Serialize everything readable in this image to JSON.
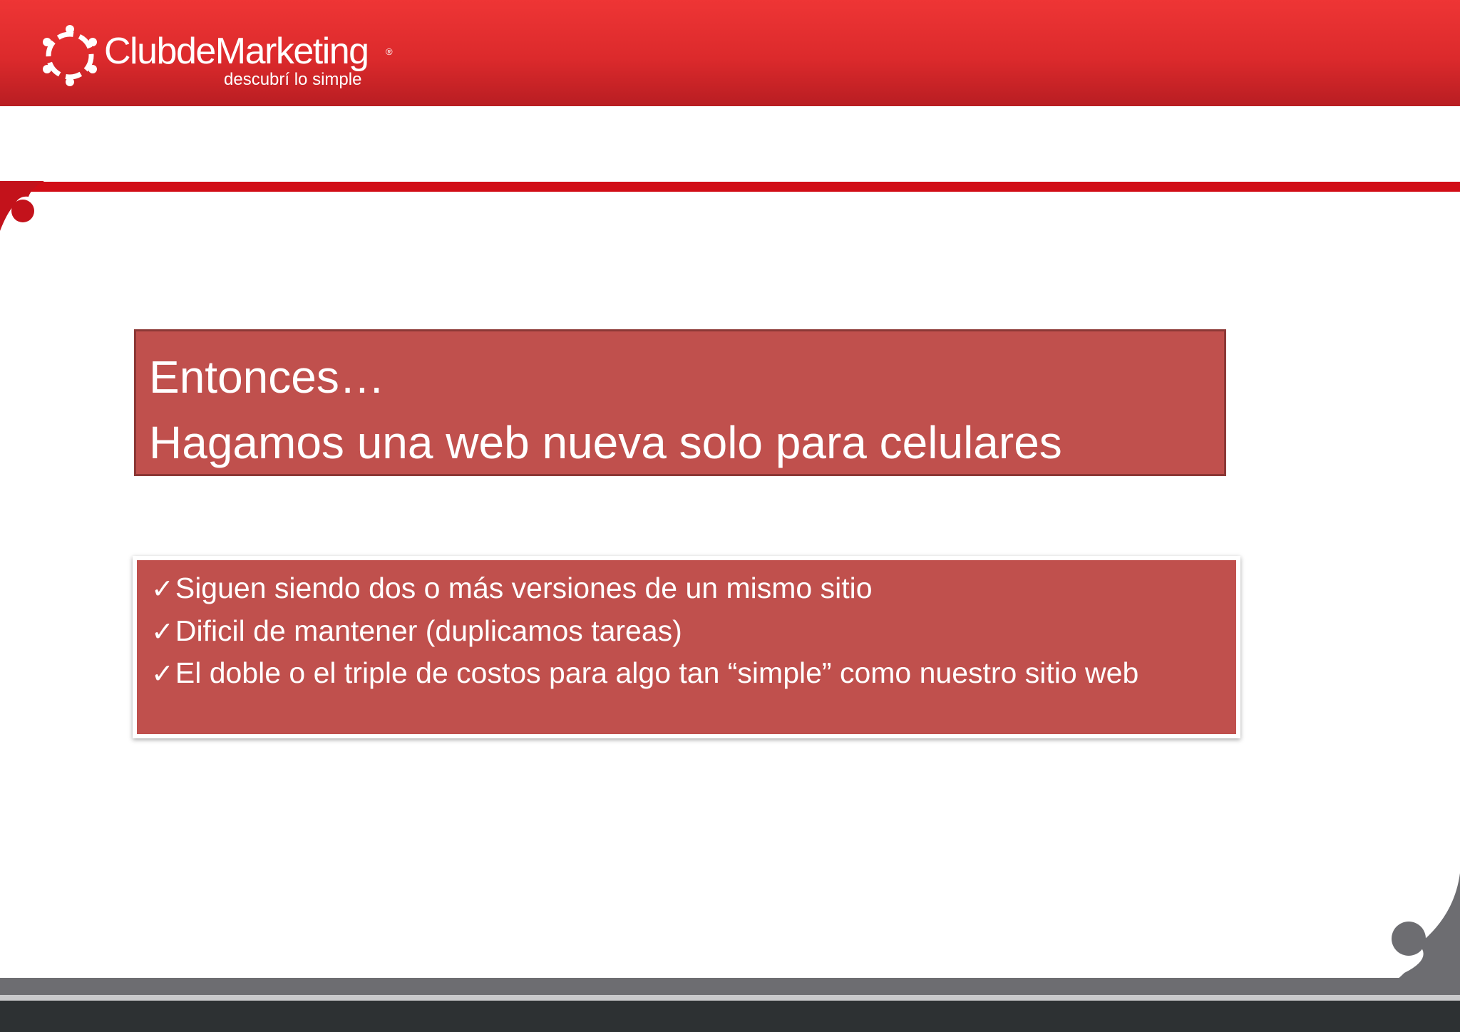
{
  "header": {
    "brand_name": "ClubdeMarketing",
    "registered_mark": "®",
    "tagline": "descubrí lo simple",
    "logo_icon": "circle-of-people-icon",
    "color": "#dc2a2c"
  },
  "title_box": {
    "line1": "Entonces…",
    "line2": "Hagamos una web nueva solo para celulares",
    "background": "#c0504d"
  },
  "points": [
    {
      "check": "✓",
      "text": "Siguen siendo dos o más versiones de un mismo sitio"
    },
    {
      "check": "✓",
      "text": "Dificil de mantener (duplicamos tareas)"
    },
    {
      "check": "✓",
      "text": "El doble o el triple de costos para algo tan “simple” como nuestro sitio web"
    }
  ],
  "colors": {
    "accent_line": "#d10d16",
    "footer_dark": "#2d3133",
    "footer_grey": "#6d6d71"
  }
}
